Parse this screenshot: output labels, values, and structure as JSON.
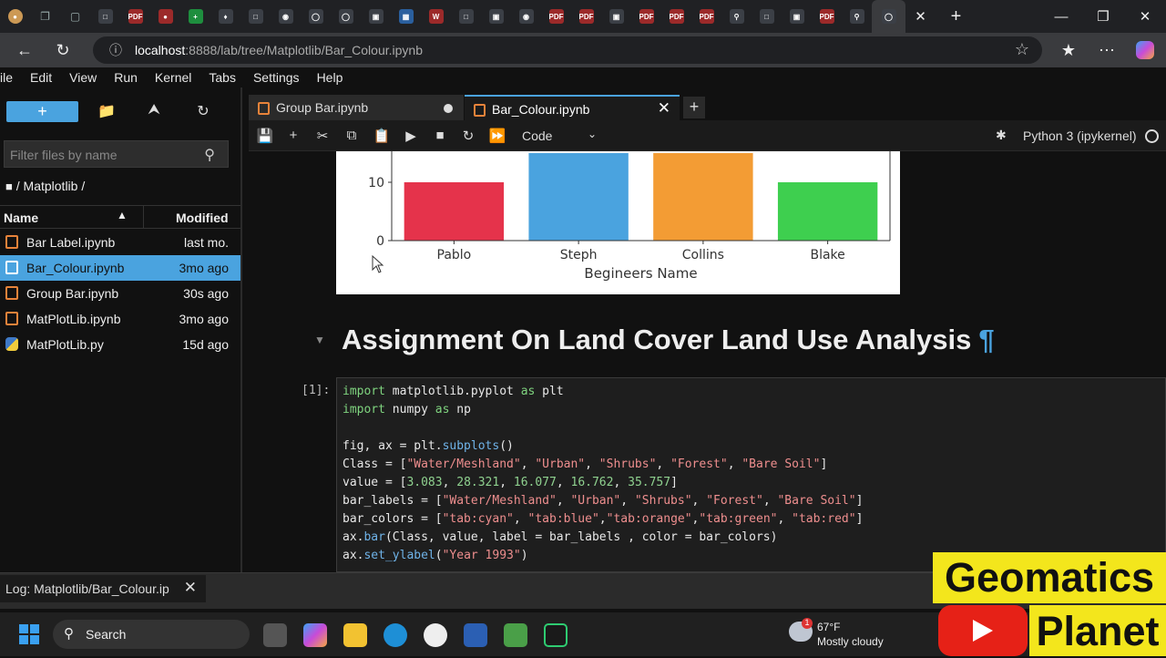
{
  "browser": {
    "url_host": "localhost",
    "url_path": ":8888/lab/tree/Matplotlib/Bar_Colour.ipynb",
    "tab_icon_labels": [
      "PDF",
      "PDF",
      "PDF",
      "PDF",
      "PDF",
      "PDF",
      "PDF",
      "PDF"
    ]
  },
  "menu": [
    "ile",
    "Edit",
    "View",
    "Run",
    "Kernel",
    "Tabs",
    "Settings",
    "Help"
  ],
  "file_browser": {
    "new_label": "+",
    "filter_placeholder": "Filter files by name",
    "breadcrumb": "/ Matplotlib /",
    "col_name": "Name",
    "col_modified": "Modified",
    "files": [
      {
        "name": "Bar Label.ipynb",
        "modified": "last mo."
      },
      {
        "name": "Bar_Colour.ipynb",
        "modified": "3mo ago"
      },
      {
        "name": "Group Bar.ipynb",
        "modified": "30s ago"
      },
      {
        "name": "MatPlotLib.ipynb",
        "modified": "3mo ago"
      },
      {
        "name": "MatPlotLib.py",
        "modified": "15d ago"
      }
    ]
  },
  "notebook": {
    "tabs": [
      "Group Bar.ipynb",
      "Bar_Colour.ipynb"
    ],
    "cell_type": "Code",
    "kernel": "Python 3 (ipykernel)",
    "heading": "Assignment On Land Cover Land Use Analysis",
    "heading_anchor": "¶",
    "prompt": "[1]:",
    "code_lines": [
      "import matplotlib.pyplot as plt",
      "import numpy as np",
      "",
      "fig, ax = plt.subplots()",
      "Class = [\"Water/Meshland\", \"Urban\", \"Shrubs\", \"Forest\", \"Bare Soil\"]",
      "value = [3.083, 28.321, 16.077, 16.762, 35.757]",
      "bar_labels = [\"Water/Meshland\", \"Urban\", \"Shrubs\", \"Forest\", \"Bare Soil\"]",
      "bar_colors = [\"tab:cyan\", \"tab:blue\",\"tab:orange\",\"tab:green\", \"tab:red\"]",
      "ax.bar(Class, value, label = bar_labels , color = bar_colors)",
      "ax.set_ylabel(\"Year 1993\")"
    ]
  },
  "chart_data": {
    "type": "bar",
    "categories": [
      "Pablo",
      "Steph",
      "Collins",
      "Blake"
    ],
    "values": [
      10,
      15,
      15,
      10
    ],
    "colors": [
      "#e5334b",
      "#4aa3df",
      "#f39c34",
      "#3ecf4f"
    ],
    "xlabel": "Begineers Name",
    "ylabel": "",
    "yticks": [
      "0",
      "10"
    ],
    "ylim": [
      0,
      15
    ]
  },
  "status": {
    "log_tab": "Log: Matplotlib/Bar_Colour.ip"
  },
  "taskbar": {
    "search": "Search",
    "temp": "67°F",
    "weather": "Mostly cloudy",
    "badge": "1"
  },
  "overlay": {
    "line1": "Geomatics",
    "line2": "Planet"
  }
}
